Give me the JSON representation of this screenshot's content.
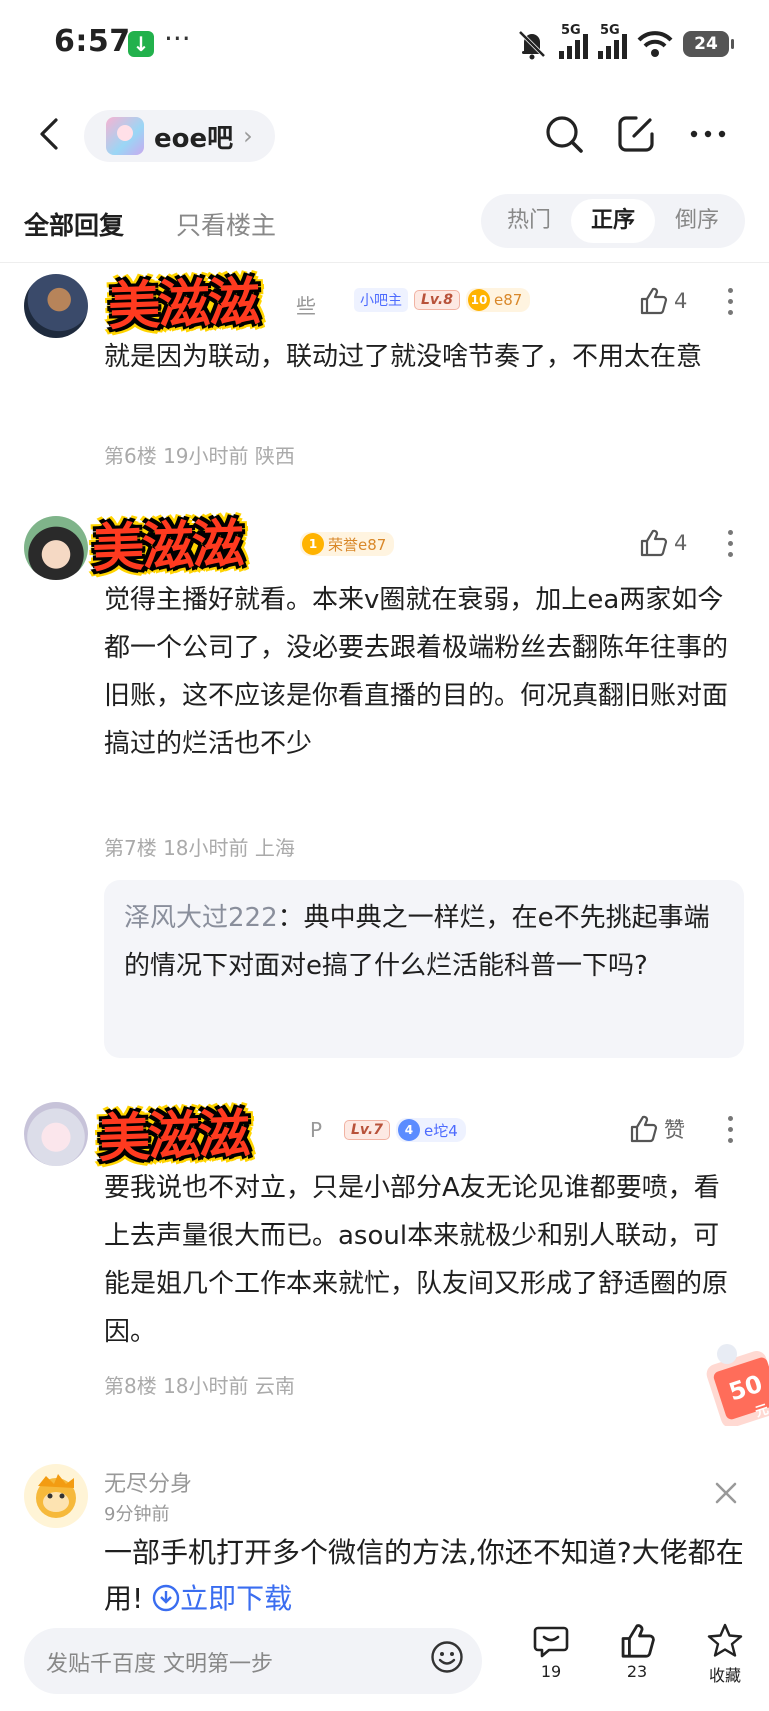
{
  "status_bar": {
    "time": "6:57",
    "extra_dots": "···",
    "signal1_label": "5G",
    "signal2_label": "5G",
    "battery": "24"
  },
  "nav": {
    "forum_name": "eoe吧",
    "chevron": "›"
  },
  "filter": {
    "tab_all": "全部回复",
    "tab_op": "只看楼主",
    "sort_hot": "热门",
    "sort_asc": "正序",
    "sort_desc": "倒序"
  },
  "posts": [
    {
      "user_partial": "些",
      "badge_admin": "小吧主",
      "badge_level": "Lv.8",
      "fan_num": "10",
      "fan_label": "e87",
      "likes": "4",
      "content": "就是因为联动，联动过了就没啥节奏了，不用太在意",
      "meta": "第6楼 19小时前 陕西",
      "sticker": "美滋滋"
    },
    {
      "fan_num": "1",
      "fan_label": "荣誉e87",
      "likes": "4",
      "content": "觉得主播好就看。本来v圈就在衰弱，加上ea两家如今都一个公司了，没必要去跟着极端粉丝去翻陈年往事的旧账，这不应该是你看直播的目的。何况真翻旧账对面搞过的烂活也不少",
      "meta": "第7楼 18小时前 上海",
      "reply_user": "泽风大过222",
      "reply_text": "：典中典之一样烂，在e不先挑起事端的情况下对面对e搞了什么烂活能科普一下吗?",
      "sticker": "美滋滋"
    },
    {
      "user_partial": "P",
      "badge_level": "Lv.7",
      "fan_num": "4",
      "fan_label": "e坨4",
      "likes": "赞",
      "content": "要我说也不对立，只是小部分A友无论见谁都要喷，看上去声量很大而已。asoul本来就极少和别人联动，可能是姐几个工作本来就忙，队友间又形成了舒适圈的原因。",
      "meta": "第8楼 18小时前 云南",
      "sticker": "美滋滋"
    }
  ],
  "coupon": {
    "value": "50",
    "suffix": "元"
  },
  "ad": {
    "name": "无尽分身",
    "time": "9分钟前",
    "text": "一部手机打开多个微信的方法,你还不知道?大佬都在用!",
    "link": "立即下载"
  },
  "bottom": {
    "input_placeholder": "发贴千百度 文明第一步",
    "comments": "19",
    "likes": "23",
    "favorite": "收藏"
  },
  "colors": {
    "accent": "#3a6df0",
    "sticker_red": "#ff3a1f",
    "sticker_yellow": "#ffd400"
  }
}
